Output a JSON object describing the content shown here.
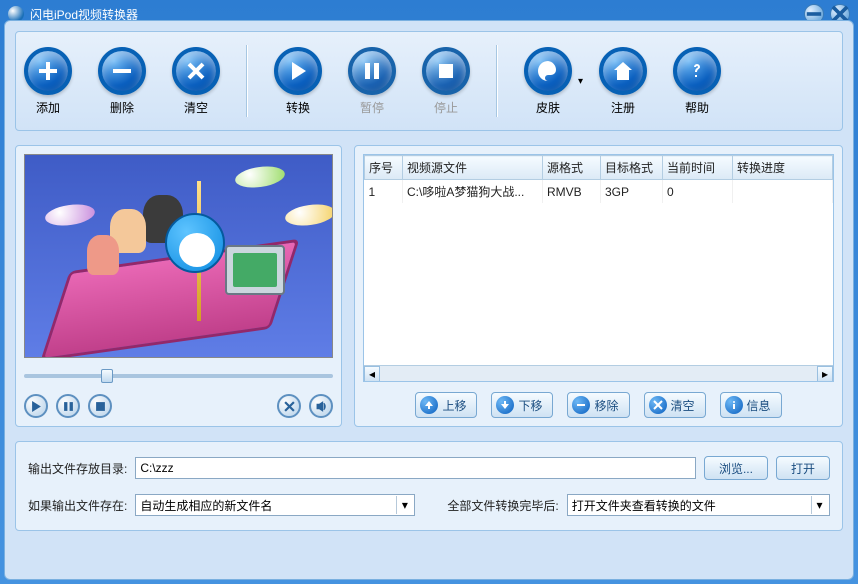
{
  "window": {
    "title": "闪电iPod视频转换器"
  },
  "toolbar": {
    "add": "添加",
    "remove": "删除",
    "clear": "清空",
    "convert": "转换",
    "pause": "暂停",
    "stop": "停止",
    "skin": "皮肤",
    "register": "注册",
    "help": "帮助"
  },
  "table": {
    "headers": {
      "index": "序号",
      "source": "视频源文件",
      "srcfmt": "源格式",
      "tgtfmt": "目标格式",
      "time": "当前时间",
      "progress": "转换进度"
    },
    "rows": [
      {
        "index": "1",
        "source": "C:\\哆啦A梦猫狗大战...",
        "srcfmt": "RMVB",
        "tgtfmt": "3GP",
        "time": "0",
        "progress": ""
      }
    ]
  },
  "listbtns": {
    "up": "上移",
    "down": "下移",
    "removeItem": "移除",
    "clearList": "清空",
    "info": "信息"
  },
  "output": {
    "dirLabel": "输出文件存放目录:",
    "dirValue": "C:\\zzz",
    "browse": "浏览...",
    "open": "打开",
    "existsLabel": "如果输出文件存在:",
    "existsValue": "自动生成相应的新文件名",
    "afterLabel": "全部文件转换完毕后:",
    "afterValue": "打开文件夹查看转换的文件"
  }
}
